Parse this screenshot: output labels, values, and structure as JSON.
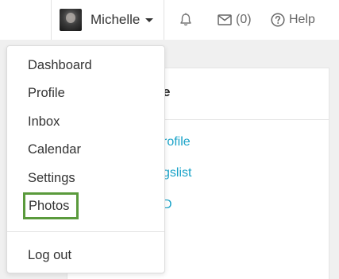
{
  "navbar": {
    "user_name": "Michelle",
    "avatar_icon": "user-avatar",
    "bell_icon": "bell-icon",
    "mail_icon": "envelope-icon",
    "mail_count": "(0)",
    "help_icon": "question-circle-icon",
    "help_label": "Help"
  },
  "dropdown": {
    "items": [
      {
        "label": "Dashboard"
      },
      {
        "label": "Profile"
      },
      {
        "label": "Inbox"
      },
      {
        "label": "Calendar"
      },
      {
        "label": "Settings"
      },
      {
        "label": "Photos"
      }
    ],
    "logout_label": "Log out",
    "highlight_color": "#5a9a3c"
  },
  "background": {
    "card_title_fragment": "e",
    "links": [
      {
        "label": "rofile"
      },
      {
        "label": "gslist"
      },
      {
        "label": "D"
      }
    ],
    "link_color": "#1aa3c8"
  }
}
